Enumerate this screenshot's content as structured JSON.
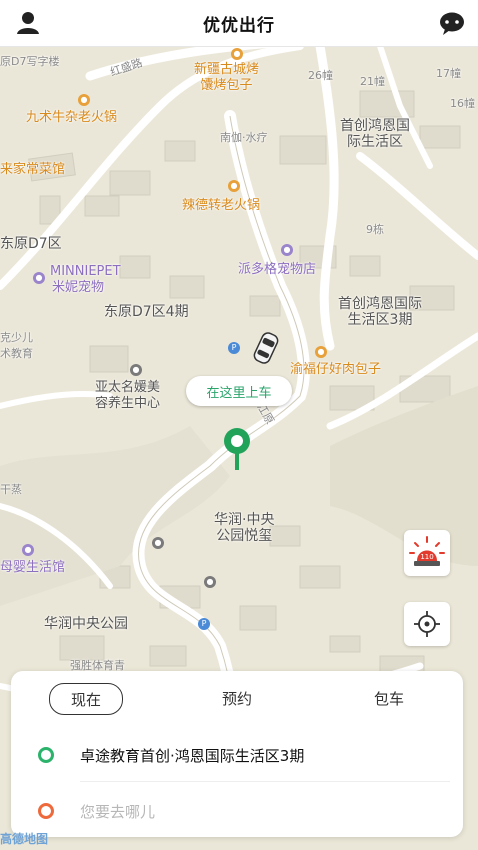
{
  "header": {
    "title": "优优出行",
    "left_icon": "user-icon",
    "right_icon": "message-icon"
  },
  "map": {
    "labels": {
      "street_top": "原D7写字楼",
      "road_hongsheng": "红盛路",
      "xinjiang_bbq": "新疆古城烤\n馕烤包子",
      "jiushu_hotpot": "九术牛杂老火锅",
      "nanjia": "南伽·水疗",
      "b26": "26幢",
      "b21": "21幢",
      "b17": "17幢",
      "b16": "16幢",
      "shouchuang_top": "首创鸿恩国\n际生活区",
      "laijia": "来家常菜馆",
      "lade_hotpot": "辣德转老火锅",
      "b9": "9栋",
      "dongyuan_d7": "东原D7区",
      "minniepet": "MINNIEPET",
      "minni_cn": "米妮宠物",
      "paiduoge": "派多格宠物店",
      "dongyuan_d7_4": "东原D7区4期",
      "shouchuang_3": "首创鸿恩国际\n生活区3期",
      "kexiaoer": "克少儿\n术教育",
      "yufuzai": "渝福仔好肉包子",
      "yatai": "亚太名媛美\n容养生中心",
      "road_jiang": "江原",
      "ganzheng": "干蒸",
      "huarun_garden": "华润·中央\n公园悦玺",
      "muying": "母婴生活馆",
      "huarun_park": "华润中央公园",
      "qiangsheng": "强胜体育青"
    },
    "pickup_bubble": "在这里上车",
    "alarm_label": "110"
  },
  "panel": {
    "tabs": [
      "现在",
      "预约",
      "包车"
    ],
    "active_tab": "现在",
    "origin": "卓途教育首创·鸿恩国际生活区3期",
    "destination_placeholder": "您要去哪儿",
    "origin_color": "#2bb36b",
    "destination_color": "#ee6a3c"
  },
  "logo": "高德地图"
}
